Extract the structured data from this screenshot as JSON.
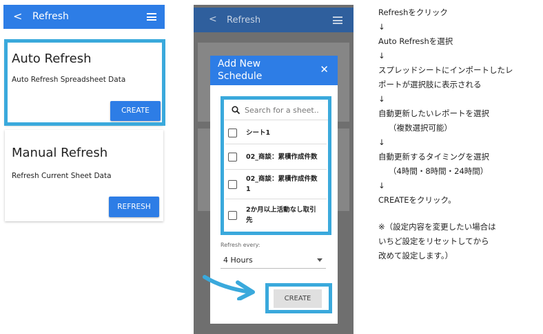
{
  "left": {
    "header": {
      "back": "<",
      "title": "Refresh"
    },
    "auto_card": {
      "title": "Auto Refresh",
      "desc": "Auto Refresh Spreadsheet Data",
      "button": "CREATE"
    },
    "manual_card": {
      "title": "Manual Refresh",
      "desc": "Refresh Current Sheet Data",
      "button": "REFRESH"
    }
  },
  "middle": {
    "header": {
      "back": "<",
      "title": "Refresh"
    },
    "modal": {
      "title_line1": "Add New",
      "title_line2": "Schedule",
      "close": "✕",
      "search_placeholder": "Search for a sheet..",
      "options": [
        {
          "line1": "シート1",
          "line2": ""
        },
        {
          "line1": "02_商談：累積作成件数",
          "line2": ""
        },
        {
          "line1": "02_商談：累積作成件数",
          "line2": "1"
        },
        {
          "line1": "2か月以上活動なし取引",
          "line2": "先"
        }
      ],
      "refresh_label": "Refresh every:",
      "refresh_value": "4 Hours",
      "create_button": "CREATE"
    }
  },
  "steps": [
    "Refreshをクリック",
    "↓",
    "Auto Refreshを選択",
    "↓",
    "スプレッドシートにインポートしたレ",
    "ポートが選択肢に表示される",
    "↓",
    "自動更新したいレポートを選択",
    "（複数選択可能）",
    "↓",
    "自動更新するタイミングを選択",
    "（4時間・8時間・24時間）",
    "↓",
    "CREATEをクリック。"
  ],
  "note": [
    "※（設定内容を変更したい場合は",
    "いちど設定をリセットしてから",
    "改めて設定します。）"
  ],
  "colors": {
    "primary": "#2d7de6",
    "highlight": "#3aa9dc",
    "overlay": "#6f6f6f"
  }
}
